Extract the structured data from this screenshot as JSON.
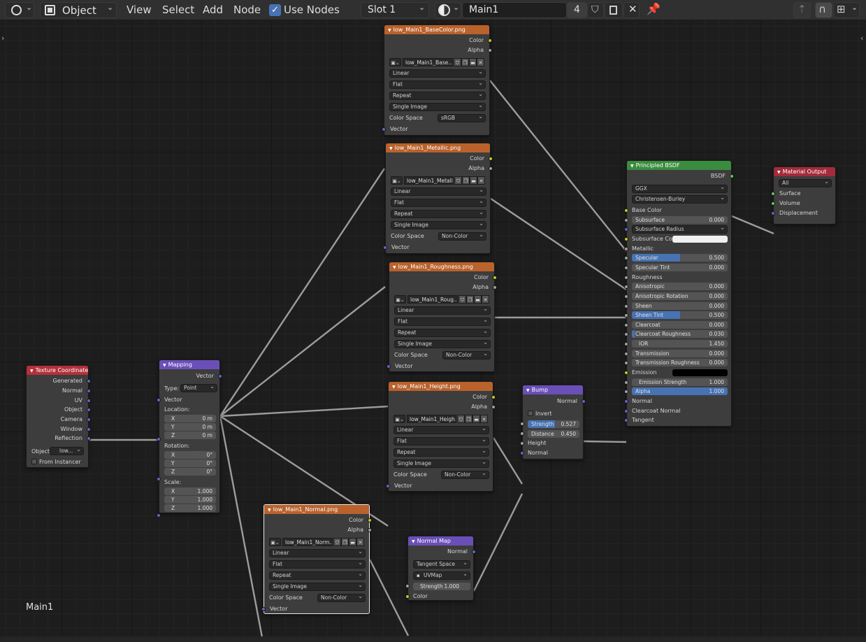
{
  "header": {
    "editor_icon": "node-editor-icon",
    "mode_label": "Object",
    "menus": [
      "View",
      "Select",
      "Add",
      "Node"
    ],
    "use_nodes_label": "Use Nodes",
    "use_nodes_checked": true,
    "slot_label": "Slot 1",
    "material_name": "Main1",
    "user_count": "4"
  },
  "tree_name": "Main1",
  "nodes": {
    "base_color": {
      "title": "low_Main1_BaseColor.png",
      "out_color": "Color",
      "out_alpha": "Alpha",
      "image_name": "low_Main1_Base...",
      "interpolation": "Linear",
      "projection": "Flat",
      "extension": "Repeat",
      "source": "Single Image",
      "color_space_label": "Color Space",
      "color_space": "sRGB",
      "in_vector": "Vector"
    },
    "metallic": {
      "title": "low_Main1_Metallic.png",
      "out_color": "Color",
      "out_alpha": "Alpha",
      "image_name": "low_Main1_Metall...",
      "interpolation": "Linear",
      "projection": "Flat",
      "extension": "Repeat",
      "source": "Single Image",
      "color_space_label": "Color Space",
      "color_space": "Non-Color",
      "in_vector": "Vector"
    },
    "roughness": {
      "title": "low_Main1_Roughness.png",
      "out_color": "Color",
      "out_alpha": "Alpha",
      "image_name": "low_Main1_Roug...",
      "interpolation": "Linear",
      "projection": "Flat",
      "extension": "Repeat",
      "source": "Single Image",
      "color_space_label": "Color Space",
      "color_space": "Non-Color",
      "in_vector": "Vector"
    },
    "height": {
      "title": "low_Main1_Height.png",
      "out_color": "Color",
      "out_alpha": "Alpha",
      "image_name": "low_Main1_Heigh...",
      "interpolation": "Linear",
      "projection": "Flat",
      "extension": "Repeat",
      "source": "Single Image",
      "color_space_label": "Color Space",
      "color_space": "Non-Color",
      "in_vector": "Vector"
    },
    "normal_tex": {
      "title": "low_Main1_Normal.png",
      "out_color": "Color",
      "out_alpha": "Alpha",
      "image_name": "low_Main1_Norm...",
      "interpolation": "Linear",
      "projection": "Flat",
      "extension": "Repeat",
      "source": "Single Image",
      "color_space_label": "Color Space",
      "color_space": "Non-Color",
      "in_vector": "Vector"
    },
    "tex_coord": {
      "title": "Texture Coordinate",
      "outputs": [
        "Generated",
        "Normal",
        "UV",
        "Object",
        "Camera",
        "Window",
        "Reflection"
      ],
      "object_label": "Object:",
      "object_value": "low...",
      "from_instancer": "From Instancer"
    },
    "mapping": {
      "title": "Mapping",
      "out_vector": "Vector",
      "type_label": "Type:",
      "type_value": "Point",
      "in_vector": "Vector",
      "location_label": "Location:",
      "location": [
        {
          "axis": "X",
          "value": "0 m"
        },
        {
          "axis": "Y",
          "value": "0 m"
        },
        {
          "axis": "Z",
          "value": "0 m"
        }
      ],
      "rotation_label": "Rotation:",
      "rotation": [
        {
          "axis": "X",
          "value": "0°"
        },
        {
          "axis": "Y",
          "value": "0°"
        },
        {
          "axis": "Z",
          "value": "0°"
        }
      ],
      "scale_label": "Scale:",
      "scale": [
        {
          "axis": "X",
          "value": "1.000"
        },
        {
          "axis": "Y",
          "value": "1.000"
        },
        {
          "axis": "Z",
          "value": "1.000"
        }
      ]
    },
    "bump": {
      "title": "Bump",
      "out_normal": "Normal",
      "invert_label": "Invert",
      "strength_label": "Strength",
      "strength_value": "0.527",
      "strength_fraction": 0.527,
      "distance_label": "Distance",
      "distance_value": "0.450",
      "in_height": "Height",
      "in_normal": "Normal"
    },
    "normal_map": {
      "title": "Normal Map",
      "out_normal": "Normal",
      "space": "Tangent Space",
      "uvmap": "UVMap",
      "strength_label": "Strength",
      "strength_value": "1.000",
      "in_color": "Color"
    },
    "bsdf": {
      "title": "Principled BSDF",
      "out_bsdf": "BSDF",
      "distribution": "GGX",
      "subsurface_method": "Christensen-Burley",
      "inputs": [
        {
          "label": "Base Color",
          "kind": "socket"
        },
        {
          "label": "Subsurface",
          "kind": "field",
          "value": "0.000",
          "fill": 0
        },
        {
          "label": "Subsurface Radius",
          "kind": "dropdown"
        },
        {
          "label": "Subsurface Co...",
          "kind": "color",
          "color": "#f0f0f0"
        },
        {
          "label": "Metallic",
          "kind": "socket"
        },
        {
          "label": "Specular",
          "kind": "field",
          "value": "0.500",
          "fill": 0.5
        },
        {
          "label": "Specular Tint",
          "kind": "field",
          "value": "0.000",
          "fill": 0
        },
        {
          "label": "Roughness",
          "kind": "socket"
        },
        {
          "label": "Anisotropic",
          "kind": "field",
          "value": "0.000",
          "fill": 0
        },
        {
          "label": "Anisotropic Rotation",
          "kind": "field",
          "value": "0.000",
          "fill": 0
        },
        {
          "label": "Sheen",
          "kind": "field",
          "value": "0.000",
          "fill": 0
        },
        {
          "label": "Sheen Tint",
          "kind": "field",
          "value": "0.500",
          "fill": 0.5
        },
        {
          "label": "Clearcoat",
          "kind": "field",
          "value": "0.000",
          "fill": 0
        },
        {
          "label": "Clearcoat Roughness",
          "kind": "field",
          "value": "0.030",
          "fill": 0.03
        },
        {
          "label": "IOR",
          "kind": "field",
          "value": "1.450",
          "fill": 0
        },
        {
          "label": "Transmission",
          "kind": "field",
          "value": "0.000",
          "fill": 0
        },
        {
          "label": "Transmission Roughness",
          "kind": "field",
          "value": "0.000",
          "fill": 0
        },
        {
          "label": "Emission",
          "kind": "color",
          "color": "#000000"
        },
        {
          "label": "Emission Strength",
          "kind": "field",
          "value": "1.000",
          "fill": 0
        },
        {
          "label": "Alpha",
          "kind": "field",
          "value": "1.000",
          "fill": 1
        },
        {
          "label": "Normal",
          "kind": "socket"
        },
        {
          "label": "Clearcoat Normal",
          "kind": "socket"
        },
        {
          "label": "Tangent",
          "kind": "socket"
        }
      ]
    },
    "output": {
      "title": "Material Output",
      "target": "All",
      "inputs": [
        "Surface",
        "Volume",
        "Displacement"
      ]
    }
  }
}
